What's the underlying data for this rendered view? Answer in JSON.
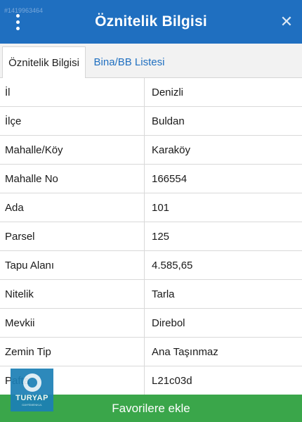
{
  "header": {
    "title": "Öznitelik Bilgisi",
    "close_symbol": "✕",
    "watermark_id": "#1419963464"
  },
  "tabs": [
    {
      "label": "Öznitelik Bilgisi",
      "active": true
    },
    {
      "label": "Bina/BB Listesi",
      "active": false
    }
  ],
  "rows": [
    {
      "key": "İl",
      "value": "Denizli"
    },
    {
      "key": "İlçe",
      "value": "Buldan"
    },
    {
      "key": "Mahalle/Köy",
      "value": "Karaköy"
    },
    {
      "key": "Mahalle No",
      "value": "166554"
    },
    {
      "key": "Ada",
      "value": "101"
    },
    {
      "key": "Parsel",
      "value": "125"
    },
    {
      "key": "Tapu Alanı",
      "value": "4.585,65"
    },
    {
      "key": "Nitelik",
      "value": "Tarla"
    },
    {
      "key": "Mevkii",
      "value": "Direbol"
    },
    {
      "key": "Zemin Tip",
      "value": "Ana Taşınmaz"
    },
    {
      "key": "Pafta",
      "value": "L21c03d"
    }
  ],
  "footer": {
    "favorite_label": "Favorilere ekle"
  },
  "logo": {
    "text": "TURYAP",
    "subtext": "GAYRİMENKUL"
  },
  "colors": {
    "header": "#1f6fc0",
    "favorite_button": "#3aa64a",
    "tab_link": "#1f6fc0"
  },
  "icons": {
    "menu": "more-vertical-icon",
    "close": "close-icon"
  }
}
